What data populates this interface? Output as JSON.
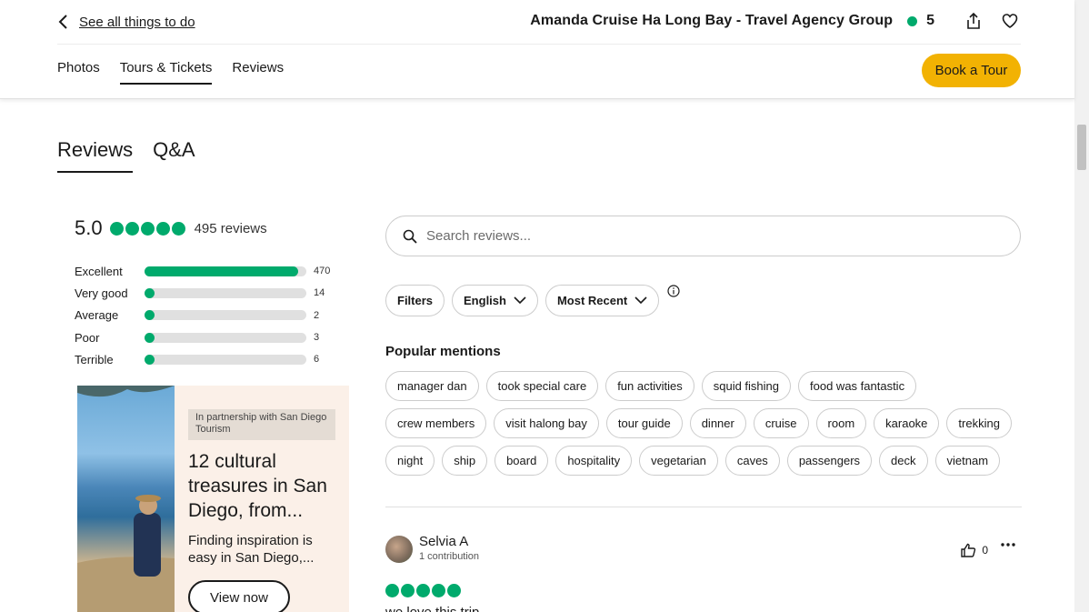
{
  "header": {
    "back_label": "See all things to do",
    "title": "Amanda Cruise Ha Long Bay - Travel Agency Group",
    "rating": "5",
    "tabs": [
      {
        "label": "Photos"
      },
      {
        "label": "Tours & Tickets",
        "active": true
      },
      {
        "label": "Reviews"
      }
    ],
    "book_label": "Book a Tour"
  },
  "section_tabs": [
    {
      "label": "Reviews",
      "active": true
    },
    {
      "label": "Q&A"
    }
  ],
  "summary": {
    "score": "5.0",
    "count_label": "495 reviews",
    "breakdown": [
      {
        "label": "Excellent",
        "count": "470",
        "fraction": 0.95
      },
      {
        "label": "Very good",
        "count": "14",
        "fraction": 0.03
      },
      {
        "label": "Average",
        "count": "2",
        "fraction": 0.004
      },
      {
        "label": "Poor",
        "count": "3",
        "fraction": 0.006
      },
      {
        "label": "Terrible",
        "count": "6",
        "fraction": 0.012
      }
    ]
  },
  "ad": {
    "partner": "In partnership with San Diego Tourism",
    "headline": "12 cultural treasures in San Diego, from...",
    "sub": "Finding inspiration is easy in San Diego,...",
    "button": "View now"
  },
  "search": {
    "placeholder": "Search reviews..."
  },
  "filters": {
    "filters_label": "Filters",
    "language": "English",
    "sort": "Most Recent"
  },
  "mentions": {
    "title": "Popular mentions",
    "items": [
      "manager dan",
      "took special care",
      "fun activities",
      "squid fishing",
      "food was fantastic",
      "crew members",
      "visit halong bay",
      "tour guide",
      "dinner",
      "cruise",
      "room",
      "karaoke",
      "trekking",
      "night",
      "ship",
      "board",
      "hospitality",
      "vegetarian",
      "caves",
      "passengers",
      "deck",
      "vietnam"
    ]
  },
  "review": {
    "name": "Selvia A",
    "contributions": "1 contribution",
    "likes": "0",
    "title": "we love this trip"
  },
  "colors": {
    "accent": "#00aa6c",
    "button": "#f2b203"
  }
}
